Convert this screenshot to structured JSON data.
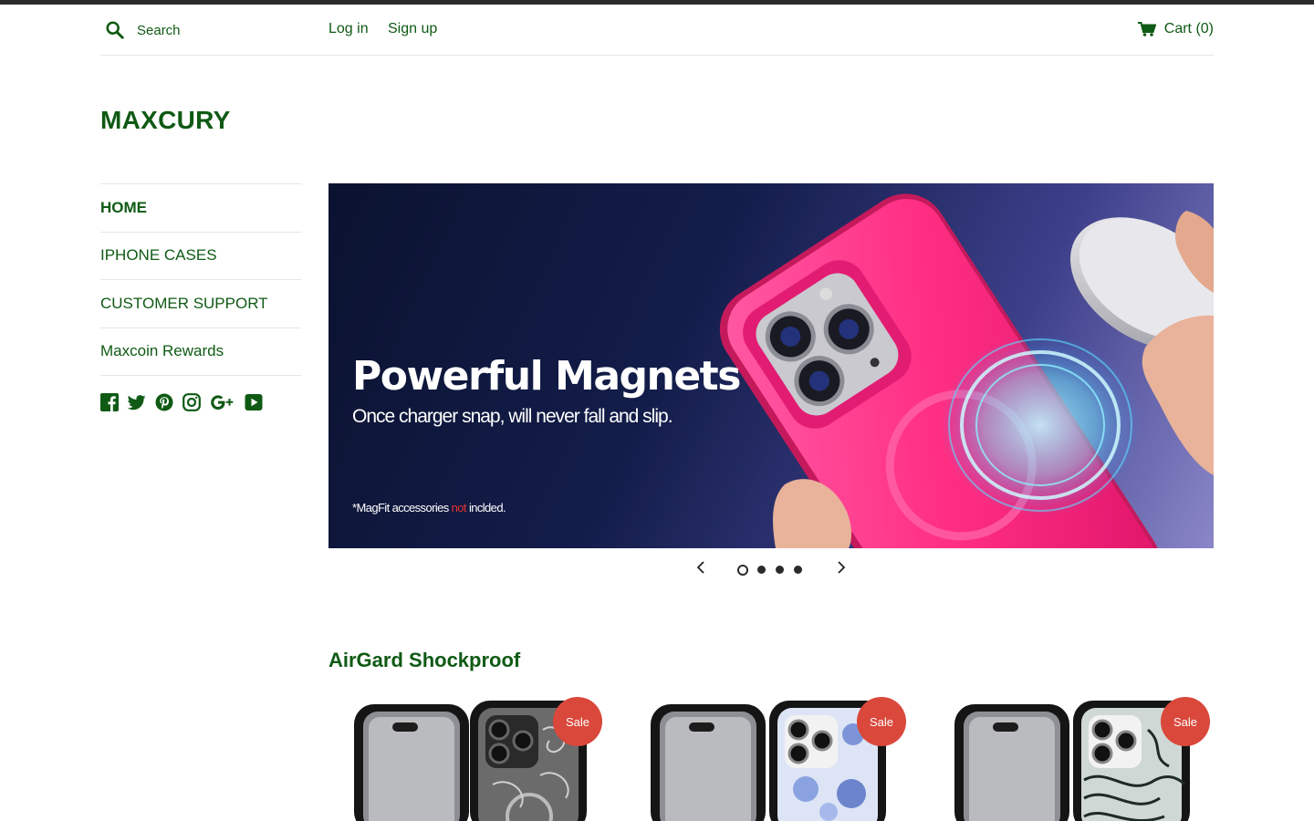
{
  "header": {
    "search_placeholder": "Search",
    "login": "Log in",
    "signup": "Sign up",
    "cart": "Cart (0)"
  },
  "site": {
    "logo": "MAXCURY"
  },
  "sidebar": {
    "items": [
      {
        "label": "HOME",
        "active": true
      },
      {
        "label": "IPHONE CASES"
      },
      {
        "label": "CUSTOMER SUPPORT"
      },
      {
        "label": "Maxcoin Rewards"
      }
    ],
    "social": [
      "facebook-icon",
      "twitter-icon",
      "pinterest-icon",
      "instagram-icon",
      "google-plus-icon",
      "youtube-icon"
    ]
  },
  "hero": {
    "headline": "Powerful Magnets",
    "subline": "Once charger snap, will never fall and slip.",
    "note_prefix": "*MagFit accessories ",
    "note_red": "not",
    "note_suffix": " inclded."
  },
  "slider": {
    "total_slides": 4,
    "active_slide": 1
  },
  "section": {
    "title": "AirGard Shockproof",
    "products": [
      {
        "badge": "Sale"
      },
      {
        "badge": "Sale"
      },
      {
        "badge": "Sale"
      }
    ]
  },
  "colors": {
    "brand_green": "#0f5a14",
    "sale_red": "#d9483b",
    "hero_pink": "#ff2e83",
    "top_bar": "#2b2b2b"
  }
}
